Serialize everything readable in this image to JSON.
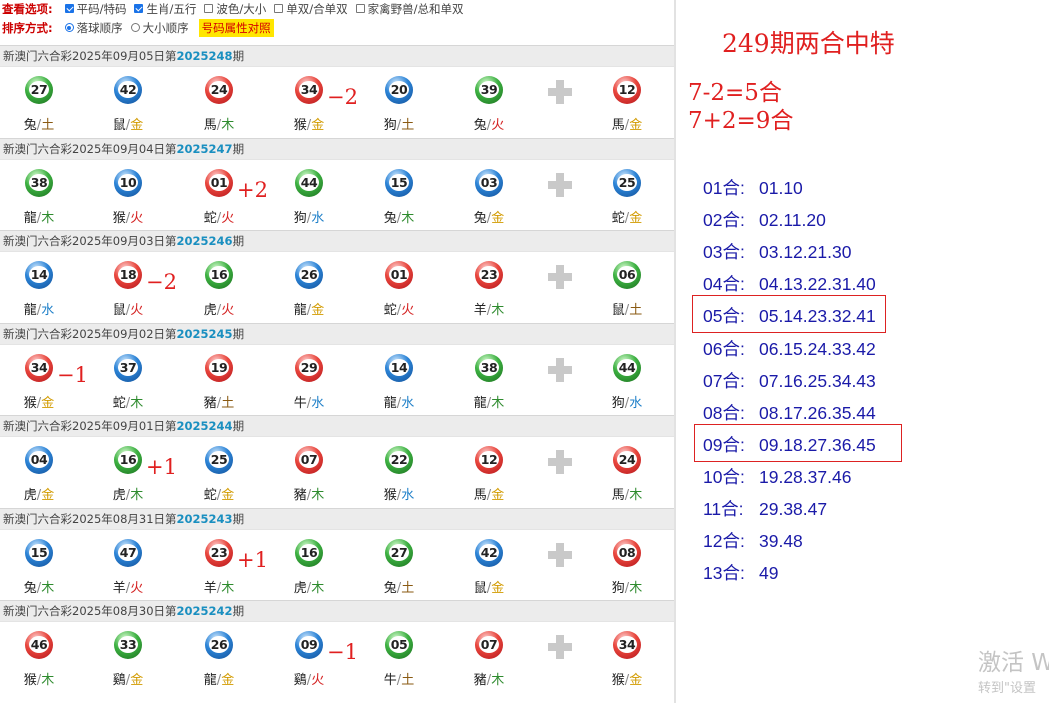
{
  "options": {
    "row1_label": "查看选项:",
    "row1_items": [
      {
        "label": "平码/特码",
        "checked": true
      },
      {
        "label": "生肖/五行",
        "checked": true
      },
      {
        "label": "波色/大小",
        "checked": false
      },
      {
        "label": "单双/合单双",
        "checked": false
      },
      {
        "label": "家禽野兽/总和单双",
        "checked": false
      }
    ],
    "row2_label": "排序方式:",
    "row2_items": [
      {
        "label": "落球顺序",
        "selected": true
      },
      {
        "label": "大小顺序",
        "selected": false
      }
    ],
    "attr_button": "号码属性对照"
  },
  "draws": [
    {
      "lottery": "新澳门六合彩",
      "date": "2025年09月05日",
      "prefix": "第",
      "issue": "2025248",
      "suffix": "期",
      "balls": [
        {
          "num": "27",
          "color": "green",
          "zodiac": "兔",
          "element": "土",
          "element_color": "earth"
        },
        {
          "num": "42",
          "color": "blue",
          "zodiac": "鼠",
          "element": "金",
          "element_color": "gold"
        },
        {
          "num": "24",
          "color": "red",
          "zodiac": "馬",
          "element": "木",
          "element_color": "wood"
        },
        {
          "num": "34",
          "color": "red",
          "zodiac": "猴",
          "element": "金",
          "element_color": "gold"
        },
        {
          "num": "20",
          "color": "blue",
          "zodiac": "狗",
          "element": "土",
          "element_color": "earth"
        },
        {
          "num": "39",
          "color": "green",
          "zodiac": "兔",
          "element": "火",
          "element_color": "fire"
        }
      ],
      "special": {
        "num": "12",
        "color": "red",
        "zodiac": "馬",
        "element": "金",
        "element_color": "gold"
      },
      "annotation": {
        "text": "−2",
        "after_ball": 3
      }
    },
    {
      "lottery": "新澳门六合彩",
      "date": "2025年09月04日",
      "prefix": "第",
      "issue": "2025247",
      "suffix": "期",
      "balls": [
        {
          "num": "38",
          "color": "green",
          "zodiac": "龍",
          "element": "木",
          "element_color": "wood"
        },
        {
          "num": "10",
          "color": "blue",
          "zodiac": "猴",
          "element": "火",
          "element_color": "fire"
        },
        {
          "num": "01",
          "color": "red",
          "zodiac": "蛇",
          "element": "火",
          "element_color": "fire"
        },
        {
          "num": "44",
          "color": "green",
          "zodiac": "狗",
          "element": "水",
          "element_color": "water"
        },
        {
          "num": "15",
          "color": "blue",
          "zodiac": "兔",
          "element": "木",
          "element_color": "wood"
        },
        {
          "num": "03",
          "color": "blue",
          "zodiac": "兔",
          "element": "金",
          "element_color": "gold"
        }
      ],
      "special": {
        "num": "25",
        "color": "blue",
        "zodiac": "蛇",
        "element": "金",
        "element_color": "gold"
      },
      "annotation": {
        "text": "+2",
        "after_ball": 2
      }
    },
    {
      "lottery": "新澳门六合彩",
      "date": "2025年09月03日",
      "prefix": "第",
      "issue": "2025246",
      "suffix": "期",
      "balls": [
        {
          "num": "14",
          "color": "blue",
          "zodiac": "龍",
          "element": "水",
          "element_color": "water"
        },
        {
          "num": "18",
          "color": "red",
          "zodiac": "鼠",
          "element": "火",
          "element_color": "fire"
        },
        {
          "num": "16",
          "color": "green",
          "zodiac": "虎",
          "element": "火",
          "element_color": "fire"
        },
        {
          "num": "26",
          "color": "blue",
          "zodiac": "龍",
          "element": "金",
          "element_color": "gold"
        },
        {
          "num": "01",
          "color": "red",
          "zodiac": "蛇",
          "element": "火",
          "element_color": "fire"
        },
        {
          "num": "23",
          "color": "red",
          "zodiac": "羊",
          "element": "木",
          "element_color": "wood"
        }
      ],
      "special": {
        "num": "06",
        "color": "green",
        "zodiac": "鼠",
        "element": "土",
        "element_color": "earth"
      },
      "annotation": {
        "text": "−2",
        "after_ball": 1
      }
    },
    {
      "lottery": "新澳门六合彩",
      "date": "2025年09月02日",
      "prefix": "第",
      "issue": "2025245",
      "suffix": "期",
      "balls": [
        {
          "num": "34",
          "color": "red",
          "zodiac": "猴",
          "element": "金",
          "element_color": "gold"
        },
        {
          "num": "37",
          "color": "blue",
          "zodiac": "蛇",
          "element": "木",
          "element_color": "wood"
        },
        {
          "num": "19",
          "color": "red",
          "zodiac": "豬",
          "element": "土",
          "element_color": "earth"
        },
        {
          "num": "29",
          "color": "red",
          "zodiac": "牛",
          "element": "水",
          "element_color": "water"
        },
        {
          "num": "14",
          "color": "blue",
          "zodiac": "龍",
          "element": "水",
          "element_color": "water"
        },
        {
          "num": "38",
          "color": "green",
          "zodiac": "龍",
          "element": "木",
          "element_color": "wood"
        }
      ],
      "special": {
        "num": "44",
        "color": "green",
        "zodiac": "狗",
        "element": "水",
        "element_color": "water"
      },
      "annotation": {
        "text": "−1",
        "after_ball": 0
      }
    },
    {
      "lottery": "新澳门六合彩",
      "date": "2025年09月01日",
      "prefix": "第",
      "issue": "2025244",
      "suffix": "期",
      "balls": [
        {
          "num": "04",
          "color": "blue",
          "zodiac": "虎",
          "element": "金",
          "element_color": "gold"
        },
        {
          "num": "16",
          "color": "green",
          "zodiac": "虎",
          "element": "木",
          "element_color": "wood"
        },
        {
          "num": "25",
          "color": "blue",
          "zodiac": "蛇",
          "element": "金",
          "element_color": "gold"
        },
        {
          "num": "07",
          "color": "red",
          "zodiac": "豬",
          "element": "木",
          "element_color": "wood"
        },
        {
          "num": "22",
          "color": "green",
          "zodiac": "猴",
          "element": "水",
          "element_color": "water"
        },
        {
          "num": "12",
          "color": "red",
          "zodiac": "馬",
          "element": "金",
          "element_color": "gold"
        }
      ],
      "special": {
        "num": "24",
        "color": "red",
        "zodiac": "馬",
        "element": "木",
        "element_color": "wood"
      },
      "annotation": {
        "text": "+1",
        "after_ball": 1
      }
    },
    {
      "lottery": "新澳门六合彩",
      "date": "2025年08月31日",
      "prefix": "第",
      "issue": "2025243",
      "suffix": "期",
      "balls": [
        {
          "num": "15",
          "color": "blue",
          "zodiac": "兔",
          "element": "木",
          "element_color": "wood"
        },
        {
          "num": "47",
          "color": "blue",
          "zodiac": "羊",
          "element": "火",
          "element_color": "fire"
        },
        {
          "num": "23",
          "color": "red",
          "zodiac": "羊",
          "element": "木",
          "element_color": "wood"
        },
        {
          "num": "16",
          "color": "green",
          "zodiac": "虎",
          "element": "木",
          "element_color": "wood"
        },
        {
          "num": "27",
          "color": "green",
          "zodiac": "兔",
          "element": "土",
          "element_color": "earth"
        },
        {
          "num": "42",
          "color": "blue",
          "zodiac": "鼠",
          "element": "金",
          "element_color": "gold"
        }
      ],
      "special": {
        "num": "08",
        "color": "red",
        "zodiac": "狗",
        "element": "木",
        "element_color": "wood"
      },
      "annotation": {
        "text": "+1",
        "after_ball": 2
      }
    },
    {
      "lottery": "新澳门六合彩",
      "date": "2025年08月30日",
      "prefix": "第",
      "issue": "2025242",
      "suffix": "期",
      "balls": [
        {
          "num": "46",
          "color": "red",
          "zodiac": "猴",
          "element": "木",
          "element_color": "wood"
        },
        {
          "num": "33",
          "color": "green",
          "zodiac": "鷄",
          "element": "金",
          "element_color": "gold"
        },
        {
          "num": "26",
          "color": "blue",
          "zodiac": "龍",
          "element": "金",
          "element_color": "gold"
        },
        {
          "num": "09",
          "color": "blue",
          "zodiac": "鷄",
          "element": "火",
          "element_color": "fire"
        },
        {
          "num": "05",
          "color": "green",
          "zodiac": "牛",
          "element": "土",
          "element_color": "earth"
        },
        {
          "num": "07",
          "color": "red",
          "zodiac": "豬",
          "element": "木",
          "element_color": "wood"
        }
      ],
      "special": {
        "num": "34",
        "color": "red",
        "zodiac": "猴",
        "element": "金",
        "element_color": "gold"
      },
      "annotation": {
        "text": "−1",
        "after_ball": 3
      }
    }
  ],
  "right_panel": {
    "title": "249期两合中特",
    "formula_1": "7-2=5合",
    "formula_2": "7+2=9合",
    "he_list": [
      {
        "label": "01合:",
        "nums": "01.10",
        "boxed": false
      },
      {
        "label": "02合:",
        "nums": "02.11.20",
        "boxed": false
      },
      {
        "label": "03合:",
        "nums": "03.12.21.30",
        "boxed": false
      },
      {
        "label": "04合:",
        "nums": "04.13.22.31.40",
        "boxed": false
      },
      {
        "label": "05合:",
        "nums": "05.14.23.32.41",
        "boxed": true
      },
      {
        "label": "06合:",
        "nums": "06.15.24.33.42",
        "boxed": false
      },
      {
        "label": "07合:",
        "nums": "07.16.25.34.43",
        "boxed": false
      },
      {
        "label": "08合:",
        "nums": "08.17.26.35.44",
        "boxed": false
      },
      {
        "label": "09合:",
        "nums": "09.18.27.36.45",
        "boxed": true
      },
      {
        "label": "10合:",
        "nums": "19.28.37.46",
        "boxed": false
      },
      {
        "label": "11合:",
        "nums": "29.38.47",
        "boxed": false
      },
      {
        "label": "12合:",
        "nums": "39.48",
        "boxed": false
      },
      {
        "label": "13合:",
        "nums": "49",
        "boxed": false
      }
    ]
  },
  "watermark": {
    "line1": "激活 W",
    "line2": "转到\"设置"
  }
}
